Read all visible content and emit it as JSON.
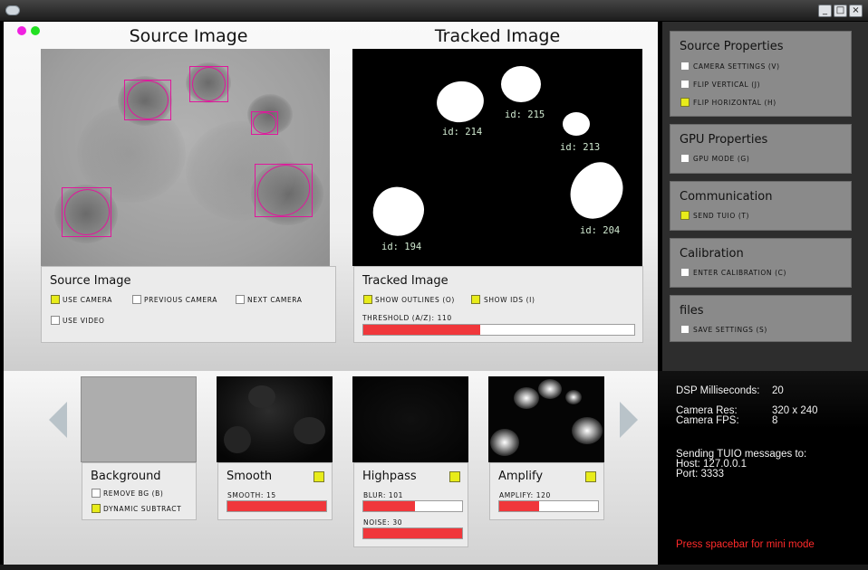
{
  "window": {
    "buttons": [
      "_",
      "□",
      "×"
    ]
  },
  "source_view": {
    "title": "Source Image",
    "panel_title": "Source Image",
    "options": [
      {
        "label": "USE CAMERA",
        "checked": true
      },
      {
        "label": "PREVIOUS CAMERA",
        "checked": false
      },
      {
        "label": "NEXT CAMERA",
        "checked": false
      },
      {
        "label": "USE VIDEO",
        "checked": false
      }
    ]
  },
  "tracked_view": {
    "title": "Tracked Image",
    "panel_title": "Tracked Image",
    "options": [
      {
        "label": "SHOW OUTLINES (O)",
        "checked": true
      },
      {
        "label": "SHOW IDS (I)",
        "checked": true
      }
    ],
    "threshold_label": "THRESHOLD (A/Z): 110",
    "threshold_fraction": 0.43,
    "blob_ids": [
      "id: 214",
      "id: 215",
      "id: 213",
      "id: 194",
      "id: 204"
    ]
  },
  "sidebar": {
    "source_properties": {
      "title": "Source Properties",
      "options": [
        {
          "label": "CAMERA SETTINGS (V)",
          "checked": false
        },
        {
          "label": "FLIP VERTICAL (J)",
          "checked": false
        },
        {
          "label": "FLIP HORIZONTAL (H)",
          "checked": true
        }
      ]
    },
    "gpu_properties": {
      "title": "GPU Properties",
      "options": [
        {
          "label": "GPU MODE (G)",
          "checked": false
        }
      ]
    },
    "communication": {
      "title": "Communication",
      "options": [
        {
          "label": "SEND TUIO (T)",
          "checked": true
        }
      ]
    },
    "calibration": {
      "title": "Calibration",
      "options": [
        {
          "label": "ENTER CALIBRATION (C)",
          "checked": false
        }
      ]
    },
    "files": {
      "title": "files",
      "options": [
        {
          "label": "SAVE SETTINGS (S)",
          "checked": false
        }
      ]
    }
  },
  "filters": {
    "background": {
      "title": "Background",
      "options": [
        {
          "label": "REMOVE BG (B)",
          "checked": false
        },
        {
          "label": "DYNAMIC SUBTRACT",
          "checked": true
        }
      ]
    },
    "smooth": {
      "title": "Smooth",
      "enabled": true,
      "slider_label": "SMOOTH: 15",
      "slider_fraction": 1.0
    },
    "highpass": {
      "title": "Highpass",
      "enabled": true,
      "blur_label": "BLUR: 101",
      "blur_fraction": 0.52,
      "noise_label": "NOISE: 30",
      "noise_fraction": 1.0
    },
    "amplify": {
      "title": "Amplify",
      "enabled": true,
      "slider_label": "AMPLIFY: 120",
      "slider_fraction": 0.4
    }
  },
  "info": {
    "dsp_label": "DSP Milliseconds:",
    "dsp_value": "20",
    "camera_res_label": "Camera Res:",
    "camera_res_value": "320 x 240",
    "camera_fps_label": "Camera FPS:",
    "camera_fps_value": "8",
    "tuio_heading": "Sending TUIO messages to:",
    "host": "Host: 127.0.0.1",
    "port": "Port: 3333",
    "mini_mode_hint": "Press spacebar for mini mode"
  },
  "colors": {
    "accent_red": "#f0373b",
    "checkbox_on": "#e8ec1a",
    "outline_magenta": "#e0179c",
    "status_magenta_dot": "#f020e0",
    "status_green_dot": "#22e022"
  }
}
